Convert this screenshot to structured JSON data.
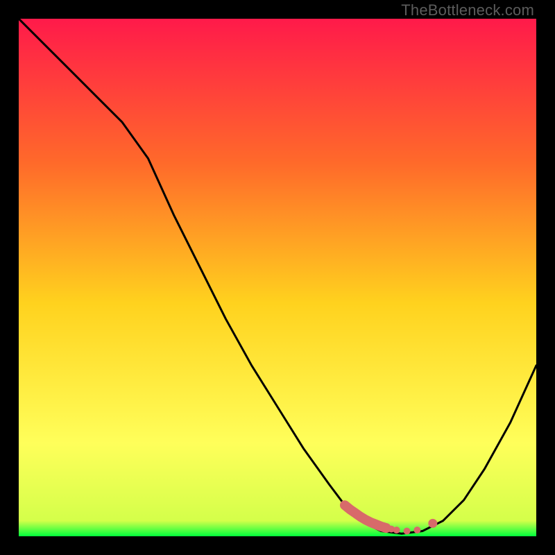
{
  "watermark": "TheBottleneck.com",
  "colors": {
    "gradient_top": "#ff1a4a",
    "gradient_mid1": "#ff6a2a",
    "gradient_mid2": "#ffd21e",
    "gradient_mid3": "#ffff5a",
    "gradient_bottom": "#00ff3c",
    "curve": "#000000",
    "marker": "#d86a6a"
  },
  "chart_data": {
    "type": "line",
    "title": "",
    "xlabel": "",
    "ylabel": "",
    "xlim": [
      0,
      100
    ],
    "ylim": [
      0,
      100
    ],
    "series": [
      {
        "name": "bottleneck-curve",
        "x": [
          0,
          5,
          10,
          15,
          20,
          25,
          30,
          35,
          40,
          45,
          50,
          55,
          60,
          63,
          66,
          70,
          74,
          78,
          82,
          86,
          90,
          95,
          100
        ],
        "y": [
          100,
          95,
          90,
          85,
          80,
          73,
          62,
          52,
          42,
          33,
          25,
          17,
          10,
          6,
          3,
          1,
          0.5,
          1,
          3,
          7,
          13,
          22,
          33
        ]
      }
    ],
    "markers": {
      "name": "highlight-segment",
      "x": [
        63,
        64,
        65,
        66,
        67,
        68,
        69,
        70,
        71,
        72,
        73,
        75,
        77,
        80
      ],
      "y": [
        6,
        5.2,
        4.5,
        3.8,
        3.2,
        2.7,
        2.3,
        1.9,
        1.6,
        1.4,
        1.2,
        1.0,
        1.2,
        2.5
      ]
    }
  }
}
